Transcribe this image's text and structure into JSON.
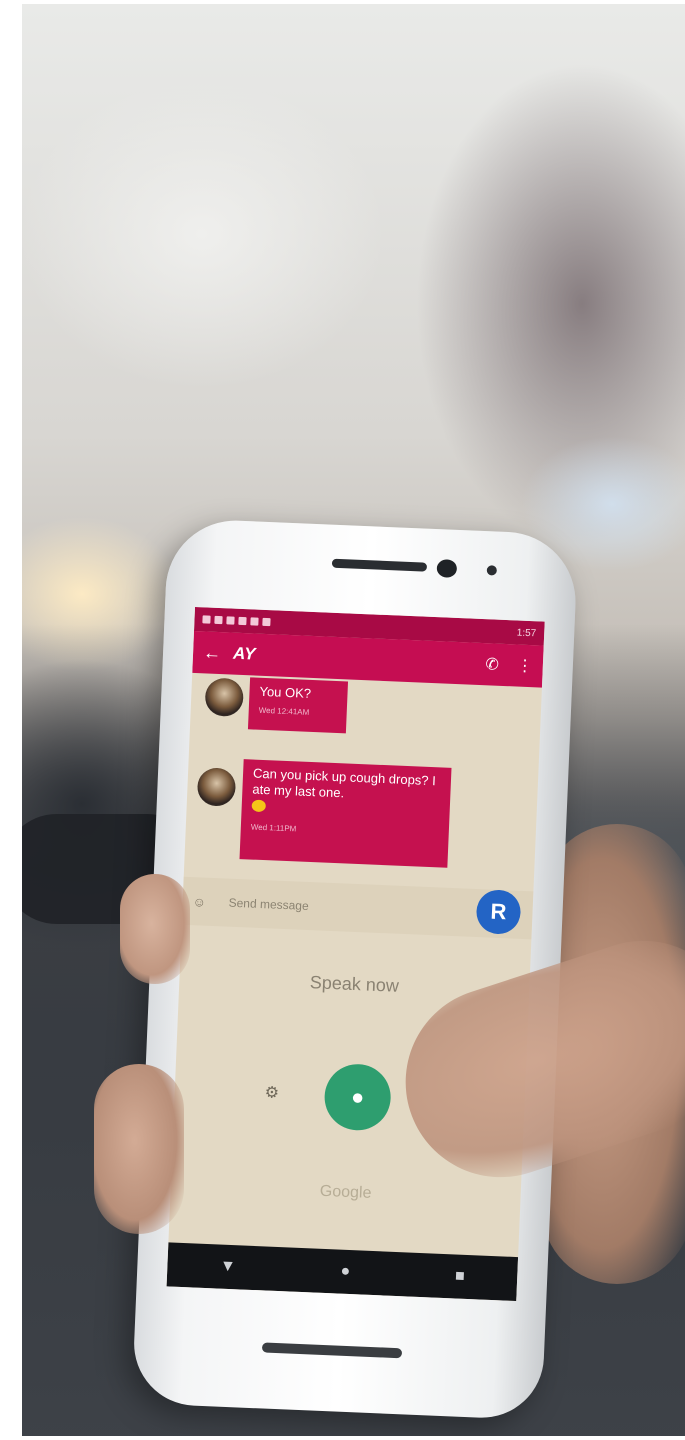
{
  "photo": {
    "subject": "hand holding smartphone in car",
    "colors": {
      "app_bar": "#c50d52",
      "bubble": "#c5114f",
      "mic_button": "#2e9e6f",
      "contact_avatar": "#2364c5"
    }
  },
  "phone": {
    "toolbar": {
      "back_icon": "arrow-left-icon",
      "title": "AY",
      "call_icon": "phone-icon",
      "menu_icon": "more-vert-icon"
    },
    "status_bar": {
      "time": "1:57"
    },
    "messages": [
      {
        "text": "You OK?",
        "time": "Wed 12:41AM"
      },
      {
        "text": "Can you pick up cough drops? I ate my last one.",
        "time": "Wed 1:11PM"
      }
    ],
    "compose": {
      "placeholder": "Send message",
      "avatar_letter": "R"
    },
    "voice": {
      "prompt": "Speak now",
      "brand": "Google"
    }
  }
}
